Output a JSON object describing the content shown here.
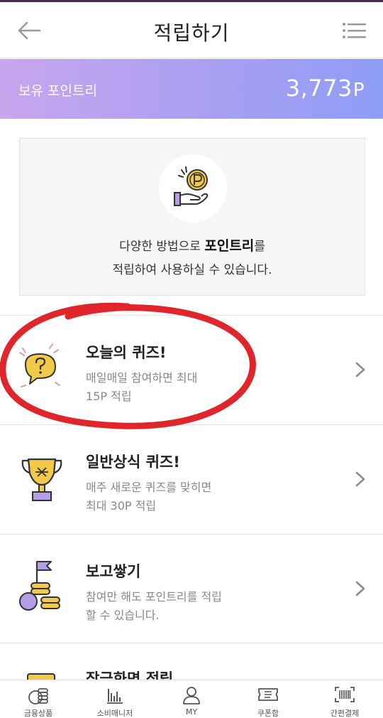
{
  "header": {
    "title": "적립하기",
    "back_icon": "back-arrow-icon",
    "menu_icon": "list-menu-icon"
  },
  "points": {
    "label": "보유 포인트리",
    "value": "3,773",
    "unit": "P"
  },
  "info": {
    "icon": "hand-coin-icon",
    "line1_prefix": "다양한 방법으로 ",
    "line1_bold": "포인트리",
    "line1_suffix": "를",
    "line2": "적립하여 사용하실 수 있습니다."
  },
  "items": [
    {
      "title": "오늘의 퀴즈!",
      "desc1": "매일매일 참여하면 최대",
      "desc2": "15P 적립",
      "icon": "speech-question-icon"
    },
    {
      "title": "일반상식 퀴즈!",
      "desc1": "매주 새로운 퀴즈를 맞히면",
      "desc2": "최대 30P 적립",
      "icon": "trophy-icon"
    },
    {
      "title": "보고쌓기",
      "desc1": "참여만 해도 포인트리를 적립",
      "desc2": "할 수 있습니다.",
      "icon": "coins-flag-icon"
    },
    {
      "title": "잠금화면 적립",
      "icon": "card-icon"
    }
  ],
  "tabs": [
    {
      "label": "금융상품",
      "icon": "coins-icon"
    },
    {
      "label": "소비매니저",
      "icon": "bar-chart-icon"
    },
    {
      "label": "MY",
      "icon": "person-icon"
    },
    {
      "label": "쿠폰함",
      "icon": "ticket-icon"
    },
    {
      "label": "간편결제",
      "icon": "barcode-icon"
    }
  ],
  "colors": {
    "gradient_start": "#c8a6ee",
    "gradient_end": "#8e9df6",
    "annotation": "#e0262a",
    "coin": "#f3c94a",
    "purple": "#b59ee8"
  }
}
